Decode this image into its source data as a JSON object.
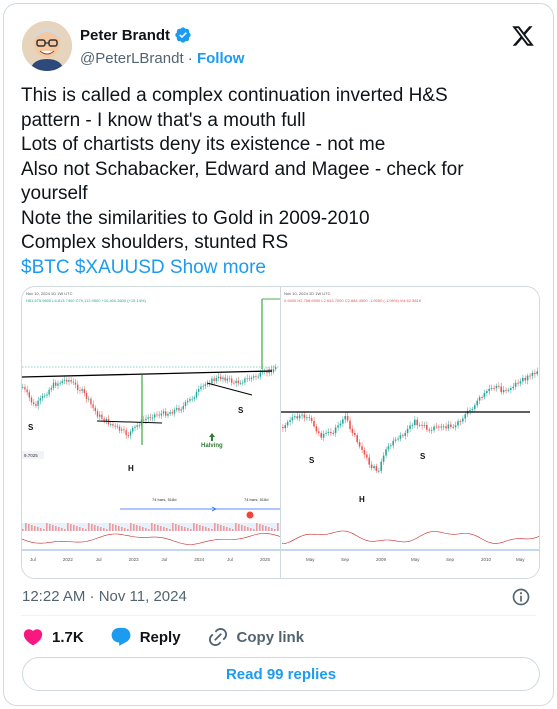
{
  "author": {
    "name": "Peter Brandt",
    "handle": "@PeterLBrandt",
    "separator": "·",
    "follow_label": "Follow"
  },
  "tweet": {
    "lines": [
      "This is called a complex continuation inverted H&S",
      "pattern - I know that's a mouth full",
      "Lots of chartists deny its existence - not me",
      "Also not Schabacker, Edward and Magee - check for",
      "yourself",
      "Note the similarities to Gold in 2009-2010",
      "Complex shoulders, stunted RS"
    ],
    "tags": "$BTC $XAUUSD",
    "show_more": "Show more"
  },
  "media": {
    "left_chart": {
      "header": "Nov 10, 2024 1D 1W UTC",
      "ohlc": "H81,675.9600  L6,813.7400  C79,112.9500  +10,400.3600 (+15.14%)",
      "labels": {
        "left_shoulder": "S",
        "head": "H",
        "right_shoulder": "S",
        "halving": "Halving"
      },
      "price_tag": "9.7025",
      "measure_1": "74 bars, 518d",
      "measure_2": "74 bars, 518d",
      "x_ticks": [
        "Jul",
        "2022",
        "Jul",
        "2023",
        "Jul",
        "2024",
        "Jul",
        "2025"
      ],
      "colors": {
        "up": "#26a69a",
        "down": "#ef5350",
        "line": "#000000",
        "green_line": "#4caf50"
      }
    },
    "right_chart": {
      "header": "Nov 10, 2024 1D 1W UTC",
      "ohlc": "0.9400  H2,758.6900  L2,643.7000  C2,684.4500  -1.9050  (-1.95%)  Vol 62.581K",
      "labels": {
        "left_shoulder": "S",
        "head": "H",
        "right_shoulder": "S"
      },
      "x_ticks": [
        "May",
        "Sep",
        "2009",
        "May",
        "Sep",
        "2010",
        "May"
      ]
    }
  },
  "timestamp": "12:22 AM · Nov 11, 2024",
  "actions": {
    "likes": "1.7K",
    "reply": "Reply",
    "copy_link": "Copy link"
  },
  "read_replies": "Read 99 replies",
  "colors": {
    "accent": "#1d9bf0",
    "like": "#f91880",
    "text": "#0f1419",
    "muted": "#536471",
    "border": "#cfd9de"
  }
}
